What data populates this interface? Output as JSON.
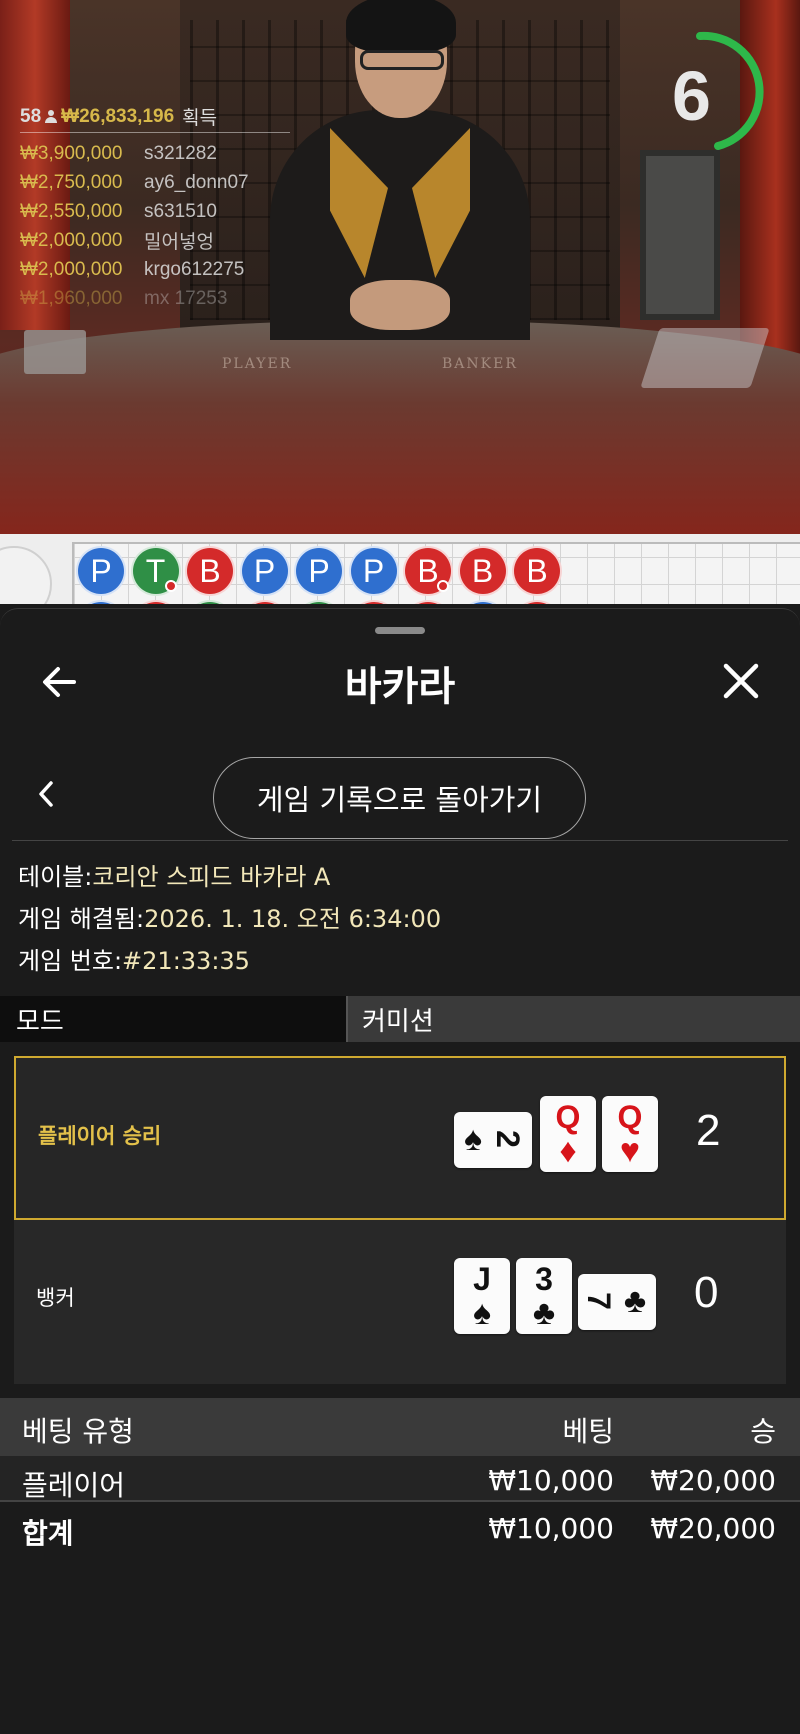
{
  "video": {
    "felt_player": "PLAYER",
    "felt_banker": "BANKER",
    "timer": "6",
    "stats": {
      "count": "58",
      "total": "₩26,833,196",
      "win_label": "획득",
      "winners": [
        {
          "amount": "₩3,900,000",
          "name": "s321282"
        },
        {
          "amount": "₩2,750,000",
          "name": "ay6_donn07"
        },
        {
          "amount": "₩2,550,000",
          "name": "s631510"
        },
        {
          "amount": "₩2,000,000",
          "name": "밀어넣엉"
        },
        {
          "amount": "₩2,000,000",
          "name": "krgo612275"
        },
        {
          "amount": "₩1,960,000",
          "name": "mx 17253"
        }
      ]
    }
  },
  "roadmap": {
    "beads": [
      {
        "label": "P",
        "type": "P"
      },
      {
        "label": "T",
        "type": "T",
        "dot": "red"
      },
      {
        "label": "B",
        "type": "B"
      },
      {
        "label": "P",
        "type": "P"
      },
      {
        "label": "P",
        "type": "P"
      },
      {
        "label": "P",
        "type": "P"
      },
      {
        "label": "B",
        "type": "B",
        "dot": "red"
      },
      {
        "label": "B",
        "type": "B"
      },
      {
        "label": "B",
        "type": "B"
      }
    ],
    "beads_row2": [
      "P",
      "B",
      "T",
      "B",
      "T",
      "B",
      "B",
      "P",
      "B"
    ]
  },
  "sheet": {
    "title": "바카라",
    "history_button": "게임 기록으로 돌아가기",
    "info": {
      "table_key": "테이블: ",
      "table_value": "코리안 스피드 바카라 A",
      "resolved_key": "게임 해결됨: ",
      "resolved_value": "2026. 1. 18. 오전 6:34:00",
      "number_key": "게임 번호: ",
      "number_value": "#21:33:35"
    },
    "tabs": {
      "mode": "모드",
      "commission": "커미션"
    },
    "result": {
      "player": {
        "label": "플레이어 승리",
        "score": "2",
        "cards": [
          {
            "rank": "2",
            "suit": "♠",
            "color": "black",
            "orientation": "sideways"
          },
          {
            "rank": "Q",
            "suit": "♦",
            "color": "red",
            "orientation": "upright"
          },
          {
            "rank": "Q",
            "suit": "♥",
            "color": "red",
            "orientation": "upright"
          }
        ]
      },
      "banker": {
        "label": "뱅커",
        "score": "0",
        "cards": [
          {
            "rank": "J",
            "suit": "♠",
            "color": "black",
            "orientation": "upright"
          },
          {
            "rank": "3",
            "suit": "♣",
            "color": "black",
            "orientation": "upright"
          },
          {
            "rank": "7",
            "suit": "♣",
            "color": "black",
            "orientation": "sideways"
          }
        ]
      }
    },
    "bets": {
      "headers": {
        "type": "베팅 유형",
        "bet": "베팅",
        "win": "승"
      },
      "rows": [
        {
          "type": "플레이어",
          "bet": "₩10,000",
          "win": "₩20,000"
        }
      ],
      "total": {
        "type": "합계",
        "bet": "₩10,000",
        "win": "₩20,000"
      }
    }
  },
  "colors": {
    "player_blue": "#2f6fcf",
    "banker_red": "#d42a2a",
    "tie_green": "#2f8f46",
    "win_highlight": "#cfa930",
    "timer_green": "#2eb84a"
  }
}
